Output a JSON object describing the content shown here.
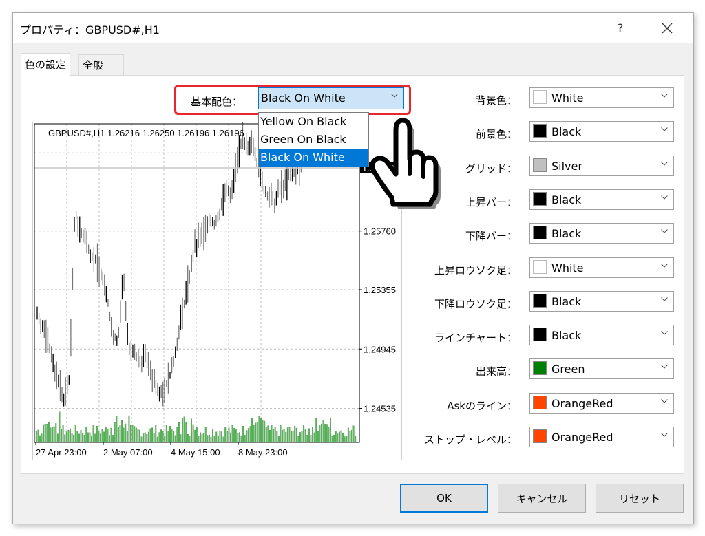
{
  "window": {
    "title": "プロパティ：GBPUSD#,H1",
    "help_label": "?",
    "close_icon": "close-icon"
  },
  "tabs": [
    {
      "label": "色の設定",
      "active": true
    },
    {
      "label": "全般",
      "active": false
    }
  ],
  "base_scheme": {
    "label": "基本配色：",
    "value": "Black On White",
    "options": [
      "Yellow On Black",
      "Green On Black",
      "Black On White"
    ],
    "selected_index": 2
  },
  "properties": [
    {
      "label": "背景色：",
      "value": "White",
      "color": "#ffffff"
    },
    {
      "label": "前景色：",
      "value": "Black",
      "color": "#000000"
    },
    {
      "label": "グリッド：",
      "value": "Silver",
      "color": "#c0c0c0"
    },
    {
      "label": "上昇バー：",
      "value": "Black",
      "color": "#000000"
    },
    {
      "label": "下降バー：",
      "value": "Black",
      "color": "#000000"
    },
    {
      "label": "上昇ロウソク足：",
      "value": "White",
      "color": "#ffffff"
    },
    {
      "label": "下降ロウソク足：",
      "value": "Black",
      "color": "#000000"
    },
    {
      "label": "ラインチャート：",
      "value": "Black",
      "color": "#000000"
    },
    {
      "label": "出来高：",
      "value": "Green",
      "color": "#008000"
    },
    {
      "label": "Askのライン：",
      "value": "OrangeRed",
      "color": "#ff4500"
    },
    {
      "label": "ストップ・レベル：",
      "value": "OrangeRed",
      "color": "#ff4500"
    }
  ],
  "buttons": {
    "ok": "OK",
    "cancel": "キャンセル",
    "reset": "リセット"
  },
  "chart_data": {
    "type": "bar",
    "title": "GBPUSD#,H1  1.26216 1.26250 1.26196 1.26196",
    "symbol": "GBPUSD#,H1",
    "ohlc_header": [
      "1.26216",
      "1.26250",
      "1.26196",
      "1.26196"
    ],
    "current_price": "1.26196",
    "y_ticks": [
      "1.25760",
      "1.25355",
      "1.24945",
      "1.24535"
    ],
    "x_ticks": [
      "27 Apr 23:00",
      "2 May 07:00",
      "4 May 15:00",
      "8 May 23:00"
    ],
    "ylim": [
      1.243,
      1.265
    ],
    "grid": true,
    "bar_color": "#000000",
    "volume_color": "#008000",
    "price_path": [
      1.252,
      1.251,
      1.25,
      1.2485,
      1.247,
      1.246,
      1.2475,
      1.259,
      1.2575,
      1.257,
      1.256,
      1.2555,
      1.2545,
      1.253,
      1.2505,
      1.25,
      1.2545,
      1.2495,
      1.249,
      1.2485,
      1.2492,
      1.248,
      1.247,
      1.2465,
      1.247,
      1.248,
      1.25,
      1.252,
      1.254,
      1.256,
      1.257,
      1.2575,
      1.2585,
      1.258,
      1.259,
      1.2605,
      1.26,
      1.2625,
      1.264,
      1.263,
      1.264,
      1.262,
      1.2605,
      1.26,
      1.2595,
      1.2605,
      1.261,
      1.2615,
      1.2618,
      1.262
    ]
  }
}
